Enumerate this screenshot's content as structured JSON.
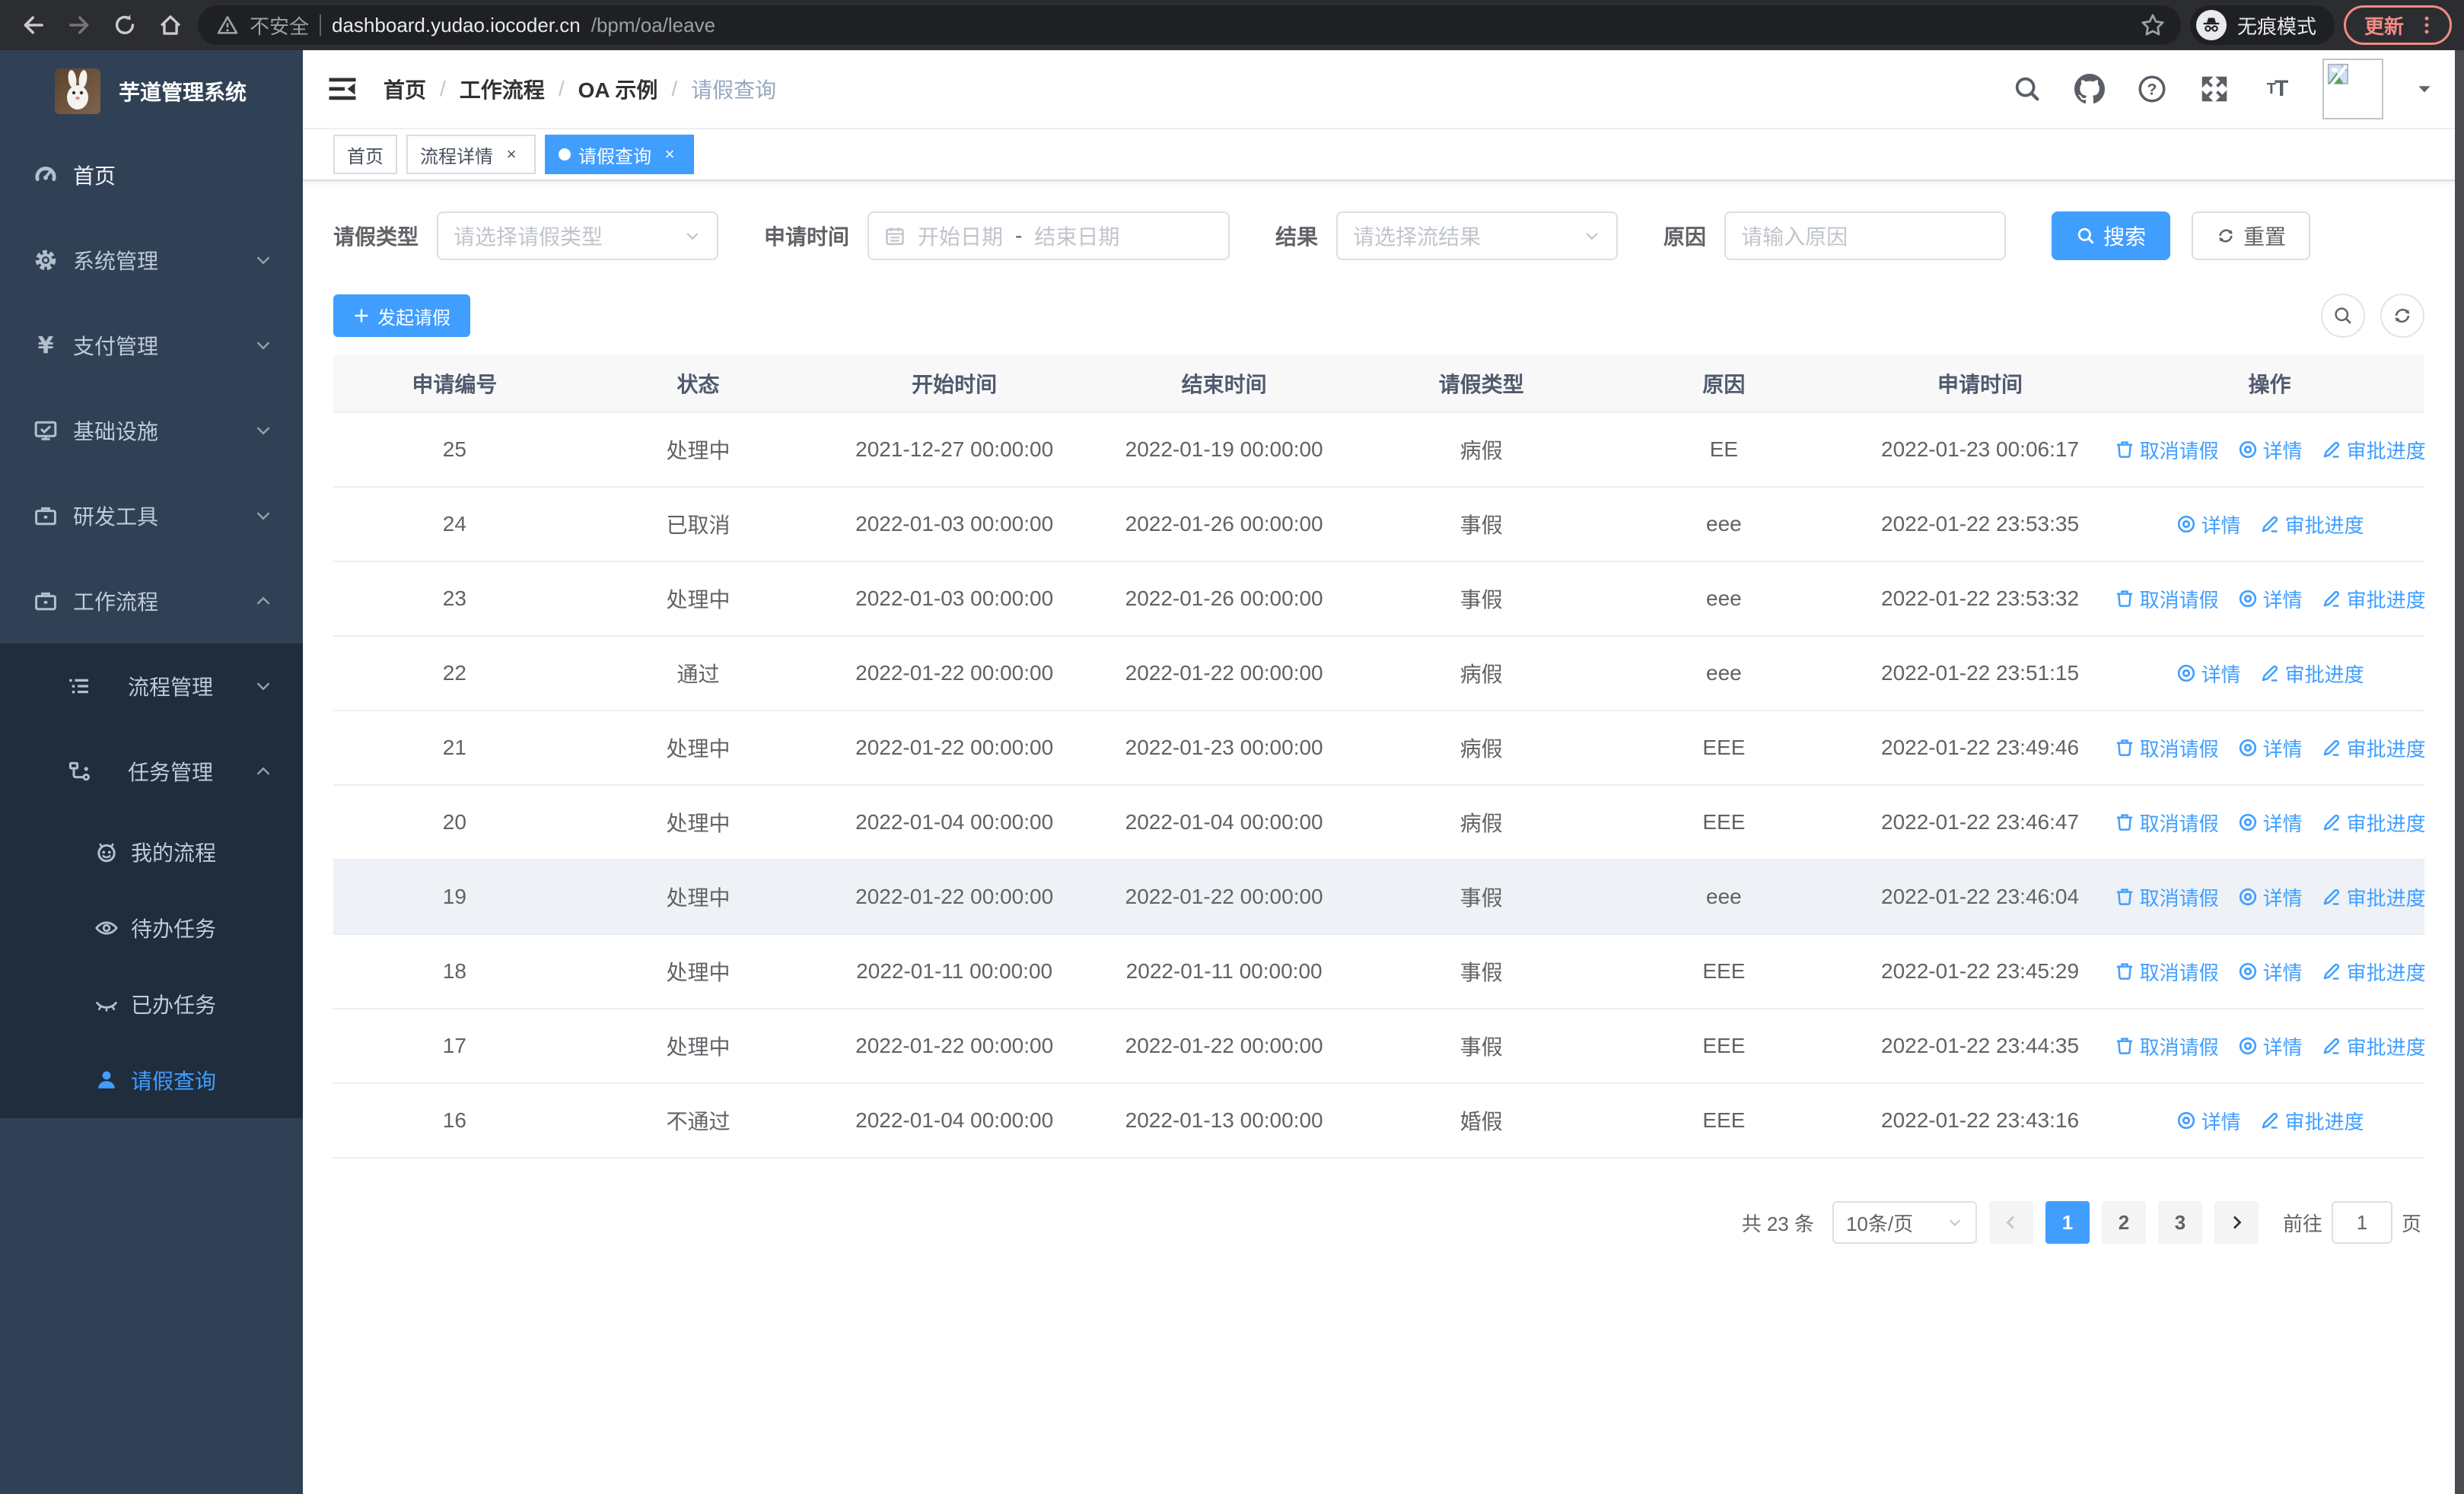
{
  "colors": {
    "accent": "#409eff",
    "sidebar_bg": "#304156",
    "submenu_bg": "#1f2d3d",
    "update_accent": "#f28b82",
    "table_header_bg": "#f8f8f9"
  },
  "browser": {
    "security_label": "不安全",
    "url_host": "dashboard.yudao.iocoder.cn",
    "url_path": "/bpm/oa/leave",
    "incognito_label": "无痕模式",
    "update_label": "更新"
  },
  "sidebar": {
    "app_title": "芋道管理系统",
    "items": [
      {
        "id": "home",
        "label": "首页",
        "icon": "dashboard",
        "level": 1,
        "chevron": null,
        "dark": false,
        "active": false,
        "bright": true
      },
      {
        "id": "system",
        "label": "系统管理",
        "icon": "gear",
        "level": 1,
        "chevron": "down",
        "dark": false,
        "active": false,
        "bright": false
      },
      {
        "id": "payment",
        "label": "支付管理",
        "icon": "yen",
        "level": 1,
        "chevron": "down",
        "dark": false,
        "active": false,
        "bright": false
      },
      {
        "id": "infra",
        "label": "基础设施",
        "icon": "monitor",
        "level": 1,
        "chevron": "down",
        "dark": false,
        "active": false,
        "bright": false
      },
      {
        "id": "devtools",
        "label": "研发工具",
        "icon": "briefcase",
        "level": 1,
        "chevron": "down",
        "dark": false,
        "active": false,
        "bright": false
      },
      {
        "id": "workflow",
        "label": "工作流程",
        "icon": "briefcase",
        "level": 1,
        "chevron": "up",
        "dark": false,
        "active": false,
        "bright": false
      },
      {
        "id": "process-mgmt",
        "label": "流程管理",
        "icon": "list",
        "level": 2,
        "chevron": "down",
        "dark": true,
        "active": false,
        "bright": false
      },
      {
        "id": "task-mgmt",
        "label": "任务管理",
        "icon": "flow",
        "level": 2,
        "chevron": "up",
        "dark": true,
        "active": false,
        "bright": false
      },
      {
        "id": "my-process",
        "label": "我的流程",
        "icon": "face",
        "level": 3,
        "chevron": null,
        "dark": true,
        "active": false,
        "bright": false
      },
      {
        "id": "todo-tasks",
        "label": "待办任务",
        "icon": "eye-open",
        "level": 3,
        "chevron": null,
        "dark": true,
        "active": false,
        "bright": false
      },
      {
        "id": "done-tasks",
        "label": "已办任务",
        "icon": "eye-closed",
        "level": 3,
        "chevron": null,
        "dark": true,
        "active": false,
        "bright": false
      },
      {
        "id": "leave-query",
        "label": "请假查询",
        "icon": "user",
        "level": 3,
        "chevron": null,
        "dark": true,
        "active": true,
        "bright": false
      }
    ]
  },
  "header": {
    "breadcrumb": [
      "首页",
      "工作流程",
      "OA 示例",
      "请假查询"
    ]
  },
  "tabs": [
    {
      "label": "首页",
      "active": false,
      "closable": false
    },
    {
      "label": "流程详情",
      "active": false,
      "closable": true
    },
    {
      "label": "请假查询",
      "active": true,
      "closable": true
    }
  ],
  "filters": {
    "leave_type_label": "请假类型",
    "leave_type_placeholder": "请选择请假类型",
    "apply_time_label": "申请时间",
    "date_start_placeholder": "开始日期",
    "date_range_separator": "-",
    "date_end_placeholder": "结束日期",
    "result_label": "结果",
    "result_placeholder": "请选择流结果",
    "reason_label": "原因",
    "reason_placeholder": "请输入原因",
    "search_button": "搜索",
    "reset_button": "重置"
  },
  "toolbar": {
    "create_button": "发起请假"
  },
  "table": {
    "columns": [
      "申请编号",
      "状态",
      "开始时间",
      "结束时间",
      "请假类型",
      "原因",
      "申请时间",
      "操作"
    ],
    "action_labels": {
      "cancel": "取消请假",
      "detail": "详情",
      "progress": "审批进度"
    },
    "rows": [
      {
        "id": "25",
        "status": "处理中",
        "start": "2021-12-27 00:00:00",
        "end": "2022-01-19 00:00:00",
        "type": "病假",
        "reason": "EE",
        "apply": "2022-01-23 00:06:17",
        "actions": [
          "cancel",
          "detail",
          "progress"
        ],
        "highlight": false
      },
      {
        "id": "24",
        "status": "已取消",
        "start": "2022-01-03 00:00:00",
        "end": "2022-01-26 00:00:00",
        "type": "事假",
        "reason": "eee",
        "apply": "2022-01-22 23:53:35",
        "actions": [
          "detail",
          "progress"
        ],
        "highlight": false
      },
      {
        "id": "23",
        "status": "处理中",
        "start": "2022-01-03 00:00:00",
        "end": "2022-01-26 00:00:00",
        "type": "事假",
        "reason": "eee",
        "apply": "2022-01-22 23:53:32",
        "actions": [
          "cancel",
          "detail",
          "progress"
        ],
        "highlight": false
      },
      {
        "id": "22",
        "status": "通过",
        "start": "2022-01-22 00:00:00",
        "end": "2022-01-22 00:00:00",
        "type": "病假",
        "reason": "eee",
        "apply": "2022-01-22 23:51:15",
        "actions": [
          "detail",
          "progress"
        ],
        "highlight": false
      },
      {
        "id": "21",
        "status": "处理中",
        "start": "2022-01-22 00:00:00",
        "end": "2022-01-23 00:00:00",
        "type": "病假",
        "reason": "EEE",
        "apply": "2022-01-22 23:49:46",
        "actions": [
          "cancel",
          "detail",
          "progress"
        ],
        "highlight": false
      },
      {
        "id": "20",
        "status": "处理中",
        "start": "2022-01-04 00:00:00",
        "end": "2022-01-04 00:00:00",
        "type": "病假",
        "reason": "EEE",
        "apply": "2022-01-22 23:46:47",
        "actions": [
          "cancel",
          "detail",
          "progress"
        ],
        "highlight": false
      },
      {
        "id": "19",
        "status": "处理中",
        "start": "2022-01-22 00:00:00",
        "end": "2022-01-22 00:00:00",
        "type": "事假",
        "reason": "eee",
        "apply": "2022-01-22 23:46:04",
        "actions": [
          "cancel",
          "detail",
          "progress"
        ],
        "highlight": true
      },
      {
        "id": "18",
        "status": "处理中",
        "start": "2022-01-11 00:00:00",
        "end": "2022-01-11 00:00:00",
        "type": "事假",
        "reason": "EEE",
        "apply": "2022-01-22 23:45:29",
        "actions": [
          "cancel",
          "detail",
          "progress"
        ],
        "highlight": false
      },
      {
        "id": "17",
        "status": "处理中",
        "start": "2022-01-22 00:00:00",
        "end": "2022-01-22 00:00:00",
        "type": "事假",
        "reason": "EEE",
        "apply": "2022-01-22 23:44:35",
        "actions": [
          "cancel",
          "detail",
          "progress"
        ],
        "highlight": false
      },
      {
        "id": "16",
        "status": "不通过",
        "start": "2022-01-04 00:00:00",
        "end": "2022-01-13 00:00:00",
        "type": "婚假",
        "reason": "EEE",
        "apply": "2022-01-22 23:43:16",
        "actions": [
          "detail",
          "progress"
        ],
        "highlight": false
      }
    ]
  },
  "pagination": {
    "total_text": "共 23 条",
    "page_size_text": "10条/页",
    "pages": [
      "1",
      "2",
      "3"
    ],
    "active_page": "1",
    "goto_label": "前往",
    "goto_value": "1",
    "goto_suffix": "页"
  }
}
